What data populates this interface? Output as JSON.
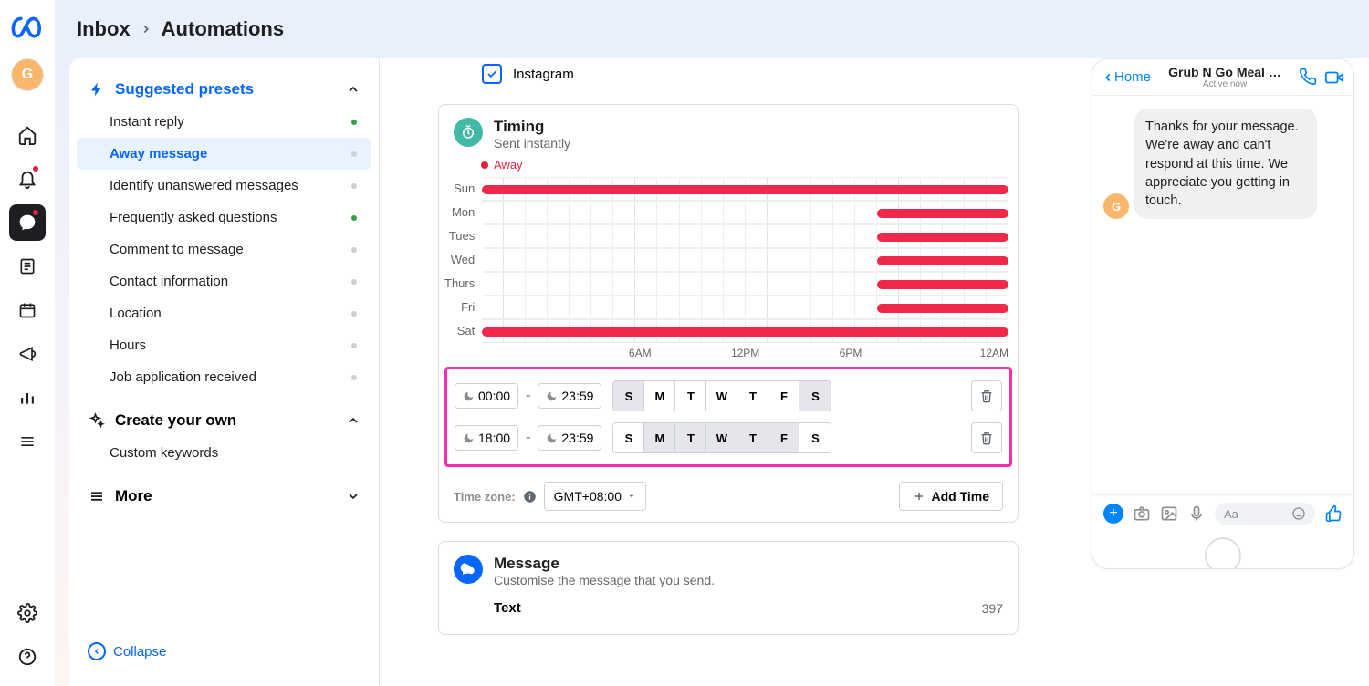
{
  "breadcrumb": {
    "parent": "Inbox",
    "current": "Automations"
  },
  "rail": {
    "avatar": "G"
  },
  "sidebar": {
    "suggested_title": "Suggested presets",
    "items": [
      {
        "label": "Instant reply",
        "status": "green"
      },
      {
        "label": "Away message",
        "status": "grey",
        "active": true
      },
      {
        "label": "Identify unanswered messages",
        "status": "grey"
      },
      {
        "label": "Frequently asked questions",
        "status": "green"
      },
      {
        "label": "Comment to message",
        "status": "grey"
      },
      {
        "label": "Contact information",
        "status": "grey"
      },
      {
        "label": "Location",
        "status": "grey"
      },
      {
        "label": "Hours",
        "status": "grey"
      },
      {
        "label": "Job application received",
        "status": "grey"
      }
    ],
    "create_title": "Create your own",
    "create_items": [
      {
        "label": "Custom keywords"
      }
    ],
    "more_title": "More",
    "collapse": "Collapse"
  },
  "channels": {
    "instagram": "Instagram"
  },
  "timing": {
    "title": "Timing",
    "subtitle": "Sent instantly",
    "away_label": "Away",
    "days": [
      "Sun",
      "Mon",
      "Tues",
      "Wed",
      "Thurs",
      "Fri",
      "Sat"
    ],
    "ticks": [
      "",
      "6AM",
      "12PM",
      "6PM",
      "12AM"
    ],
    "rows": [
      {
        "start": "00:00",
        "end": "23:59",
        "days_on": [
          true,
          false,
          false,
          false,
          false,
          false,
          true
        ]
      },
      {
        "start": "18:00",
        "end": "23:59",
        "days_on": [
          false,
          true,
          true,
          true,
          true,
          true,
          false
        ]
      }
    ],
    "dow_labels": [
      "S",
      "M",
      "T",
      "W",
      "T",
      "F",
      "S"
    ],
    "tz_label": "Time zone:",
    "tz_value": "GMT+08:00",
    "add_time": "Add Time"
  },
  "message": {
    "title": "Message",
    "subtitle": "Customise the message that you send.",
    "text_label": "Text",
    "char_count": "397"
  },
  "preview": {
    "home": "Home",
    "title": "Grub N Go Meal …",
    "subtitle": "Active now",
    "bubble": "Thanks for your message. We're away and can't respond at this time. We appreciate you getting in touch.",
    "avatar": "G",
    "placeholder": "Aa"
  }
}
